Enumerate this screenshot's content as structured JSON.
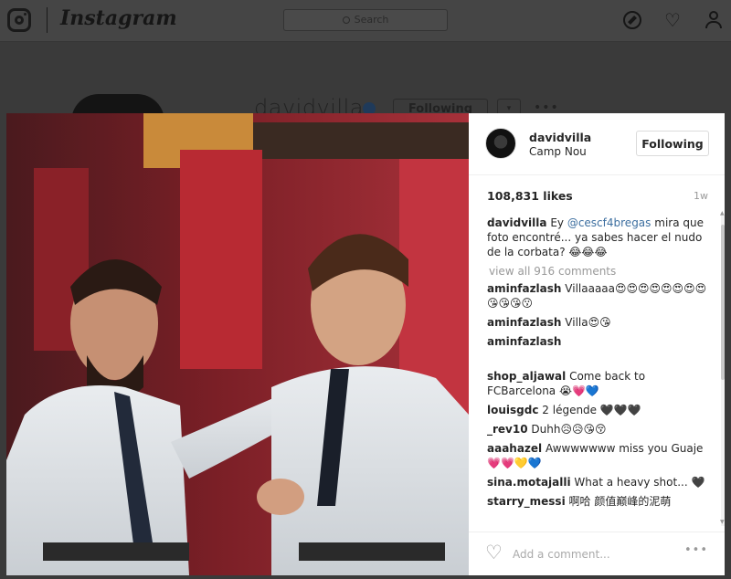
{
  "background": {
    "wordmark": "Instagram",
    "search_placeholder": "Search",
    "profile_username": "davidvilla",
    "follow_button": "Following",
    "dropdown": "▾",
    "more": "•••"
  },
  "post": {
    "username": "davidvilla",
    "location": "Camp Nou",
    "follow_button": "Following",
    "likes": "108,831 likes",
    "age": "1w",
    "caption": {
      "user": "davidvilla",
      "before": "Ey",
      "mention": "@cescf4bregas",
      "after": "mira que foto encontré... ya sabes hacer el nudo de la corbata? 😂😂😂"
    },
    "view_all": "view all 916 comments",
    "comments": [
      {
        "user": "aminfazlash",
        "text": "Villaaaaa😍😍😍😍😍😍😍😍😘😘😘😗"
      },
      {
        "user": "aminfazlash",
        "text": "Villa😍😘"
      },
      {
        "user": "aminfazlash",
        "text": ""
      },
      {
        "user": "shop_aljawal",
        "text": "Come back to FCBarcelona 😭💗💙"
      },
      {
        "user": "louisgdc",
        "text": "2 légende 🖤🖤🖤"
      },
      {
        "user": "_rev10",
        "text": "Duhh😥😥😘😚"
      },
      {
        "user": "aaahazel",
        "text": "Awwwwwww miss you Guaje💗💗💛💙"
      },
      {
        "user": "sina.motajalli",
        "text": "What a heavy shot... 🖤"
      },
      {
        "user": "starry_messi",
        "text": "啊哈 颜值巅峰的泥萌"
      }
    ],
    "add_comment_placeholder": "Add a comment...",
    "more_options": "•••"
  },
  "colors": {
    "mention": "#3d6fa0",
    "muted": "#999999",
    "overlay": "#3a3a3a"
  },
  "icons": [
    "instagram-logo-icon",
    "search-icon",
    "compass-icon",
    "heart-icon",
    "person-icon",
    "verified-badge-icon",
    "like-heart-icon",
    "more-options-icon"
  ]
}
